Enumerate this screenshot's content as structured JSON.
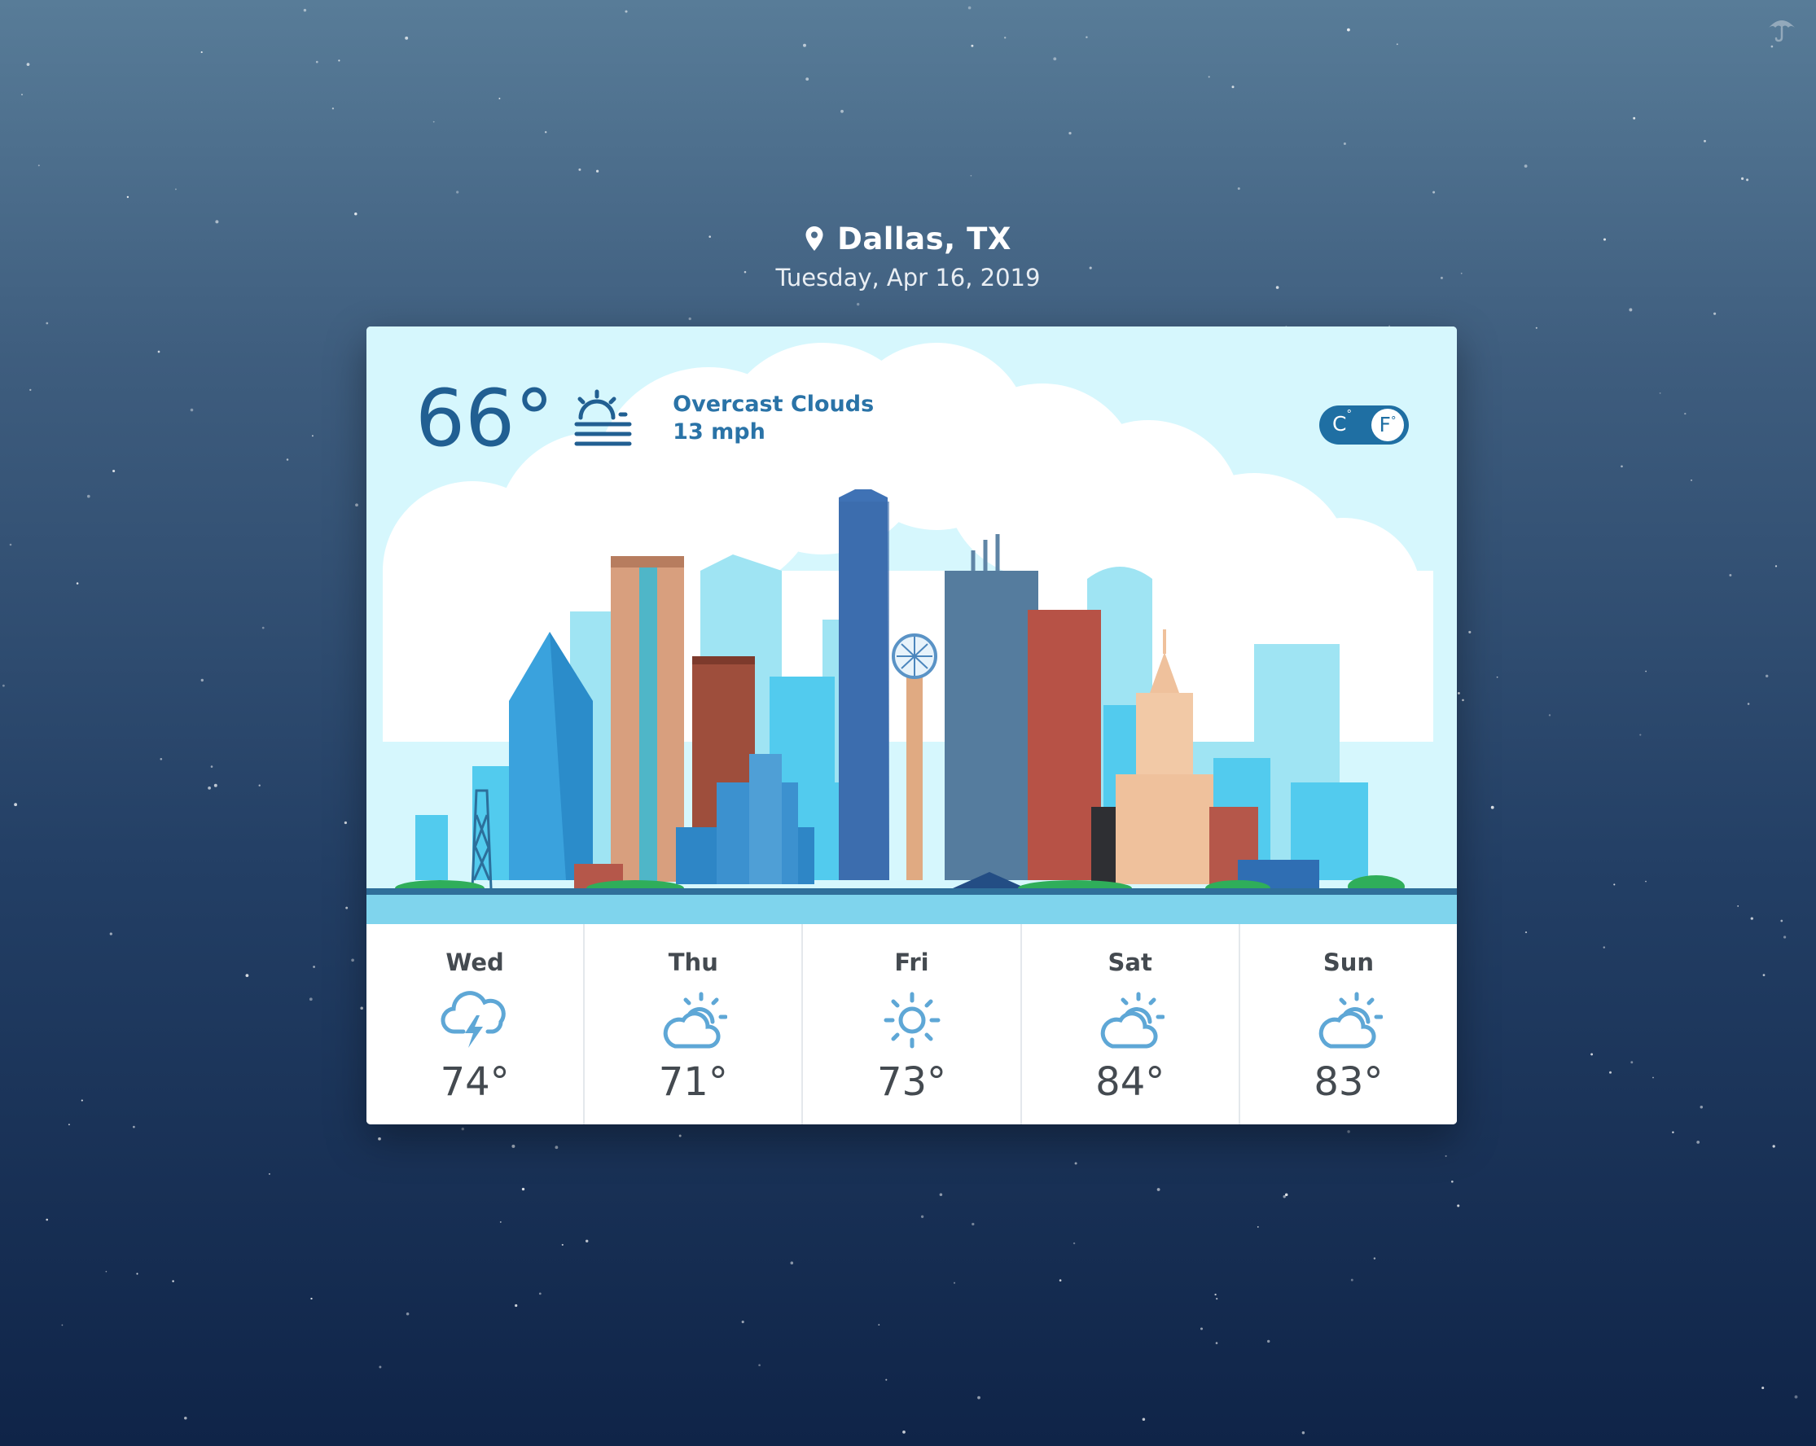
{
  "location": {
    "city": "Dallas, TX",
    "date": "Tuesday, Apr 16, 2019",
    "pin_icon": "map-pin-icon"
  },
  "current": {
    "temperature": "66°",
    "condition": "Overcast Clouds",
    "wind": "13 mph",
    "icon": "sun-behind-fog-icon"
  },
  "units": {
    "celsius_label": "C",
    "fahrenheit_label": "F",
    "selected": "F"
  },
  "forecast": [
    {
      "day": "Wed",
      "temp": "74°",
      "icon": "thunderstorm-icon"
    },
    {
      "day": "Thu",
      "temp": "71°",
      "icon": "partly-cloudy-icon"
    },
    {
      "day": "Fri",
      "temp": "73°",
      "icon": "sun-icon"
    },
    {
      "day": "Sat",
      "temp": "84°",
      "icon": "partly-cloudy-icon"
    },
    {
      "day": "Sun",
      "temp": "83°",
      "icon": "partly-cloudy-icon"
    }
  ],
  "colors": {
    "accent": "#215f92",
    "sky": "#d6f7fd",
    "icon_blue": "#5ea7d6",
    "text_dark": "#444a50"
  },
  "corner_icon": "umbrella-icon"
}
